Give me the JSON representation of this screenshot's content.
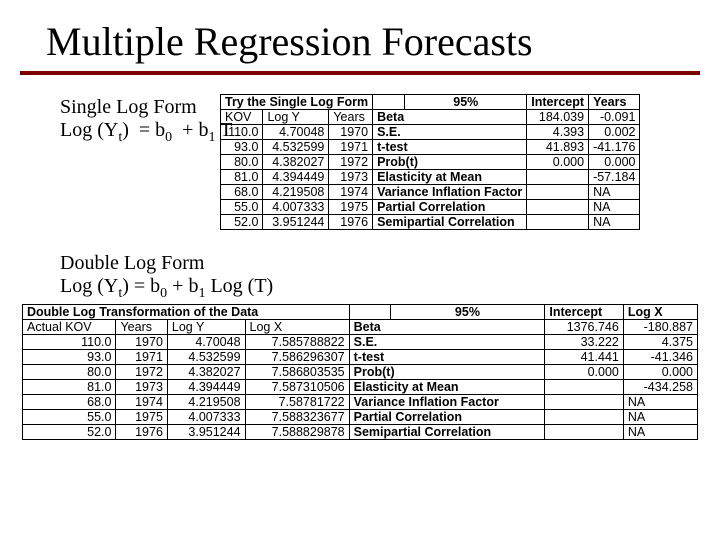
{
  "title": "Multiple Regression Forecasts",
  "single": {
    "heading1": "Single Log Form",
    "heading2_html": "Log (Yₜ)  = b₀  + b₁ T"
  },
  "double": {
    "heading1": "Double Log Form",
    "heading2_html": "Log (Yₜ) = b₀ + b₁ Log (T)"
  },
  "table1": {
    "header": {
      "title": "Try the Single Log Form",
      "ci": "95%",
      "c_int": "Intercept",
      "c_x": "Years"
    },
    "cols": {
      "kov": "KOV",
      "logy": "Log Y",
      "years": "Years"
    },
    "stats": [
      "Beta",
      "S.E.",
      "t-test",
      "Prob(t)",
      "Elasticity at Mean",
      "Variance Inflation Factor",
      "Partial Correlation",
      "Semipartial Correlation"
    ],
    "intcpt": [
      "184.039",
      "4.393",
      "41.893",
      "0.000",
      "",
      "",
      "",
      ""
    ],
    "xvals": [
      "-0.091",
      "0.002",
      "-41.176",
      "0.000",
      "-57.184",
      "NA",
      "NA",
      "NA"
    ],
    "data": [
      [
        "110.0",
        "4.70048",
        "1970"
      ],
      [
        "93.0",
        "4.532599",
        "1971"
      ],
      [
        "80.0",
        "4.382027",
        "1972"
      ],
      [
        "81.0",
        "4.394449",
        "1973"
      ],
      [
        "68.0",
        "4.219508",
        "1974"
      ],
      [
        "55.0",
        "4.007333",
        "1975"
      ],
      [
        "52.0",
        "3.951244",
        "1976"
      ]
    ]
  },
  "table2": {
    "header": {
      "title": "Double Log Transformation of the Data",
      "ci": "95%",
      "c_int": "Intercept",
      "c_x": "Log X"
    },
    "cols": {
      "kov": "Actual KOV",
      "years": "Years",
      "logy": "Log Y",
      "logx": "Log X"
    },
    "stats": [
      "Beta",
      "S.E.",
      "t-test",
      "Prob(t)",
      "Elasticity at Mean",
      "Variance Inflation Factor",
      "Partial Correlation",
      "Semipartial Correlation"
    ],
    "intcpt": [
      "1376.746",
      "33.222",
      "41.441",
      "0.000",
      "",
      "",
      "",
      ""
    ],
    "xvals": [
      "-180.887",
      "4.375",
      "-41.346",
      "0.000",
      "-434.258",
      "NA",
      "NA",
      "NA"
    ],
    "data": [
      [
        "110.0",
        "1970",
        "4.70048",
        "7.585788822"
      ],
      [
        "93.0",
        "1971",
        "4.532599",
        "7.586296307"
      ],
      [
        "80.0",
        "1972",
        "4.382027",
        "7.586803535"
      ],
      [
        "81.0",
        "1973",
        "4.394449",
        "7.587310506"
      ],
      [
        "68.0",
        "1974",
        "4.219508",
        "7.58781722"
      ],
      [
        "55.0",
        "1975",
        "4.007333",
        "7.588323677"
      ],
      [
        "52.0",
        "1976",
        "3.951244",
        "7.588829878"
      ]
    ]
  }
}
